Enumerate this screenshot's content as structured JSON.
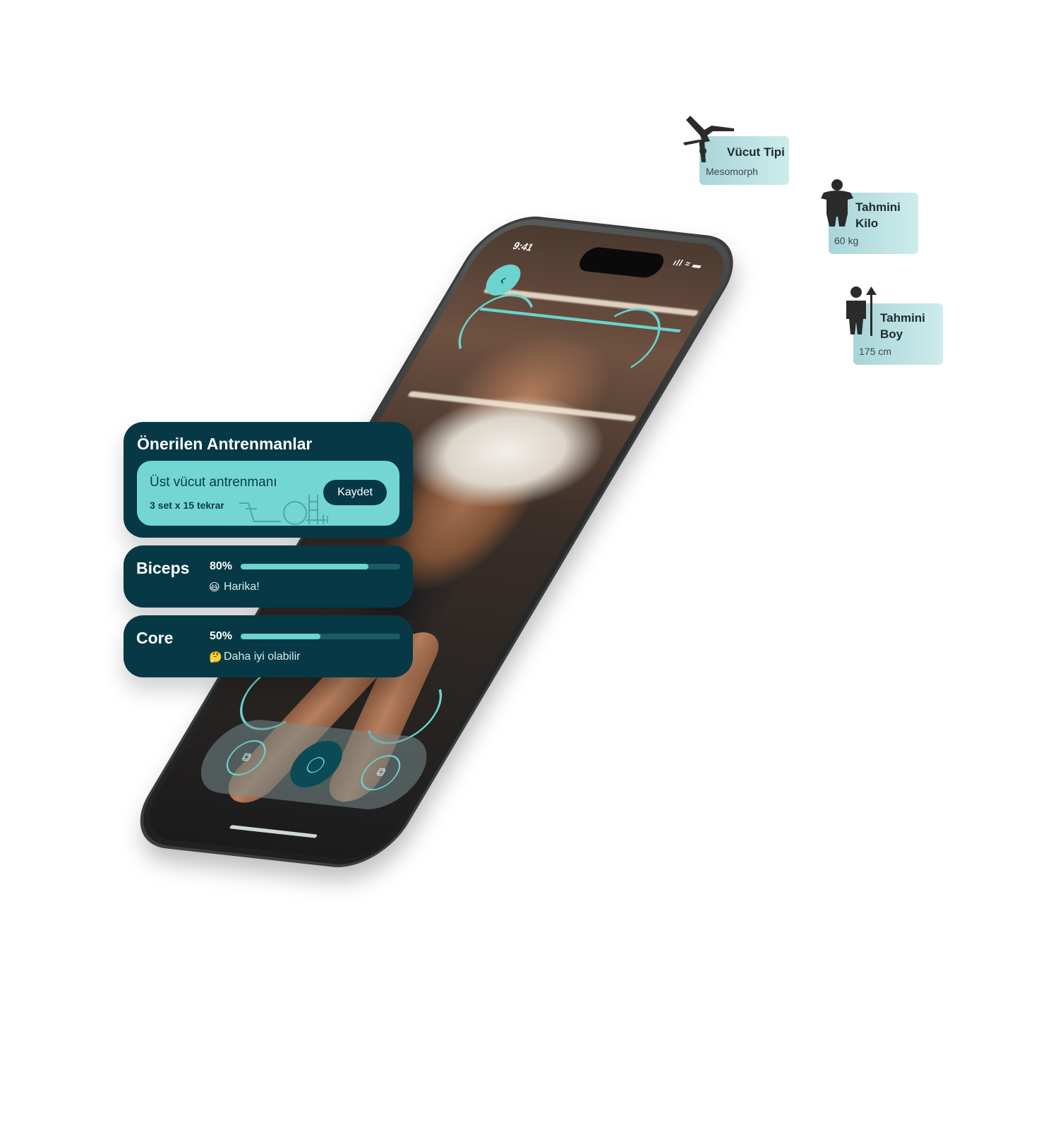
{
  "status_bar": {
    "time": "9:41",
    "icons": "ıll ≈ ▬"
  },
  "camera": {
    "back_icon": "‹",
    "shutter_icon": "◯",
    "left_icon": "⧉",
    "right_icon": "⧉"
  },
  "recommended": {
    "title": "Önerilen Antrenmanlar",
    "workout_name": "Üst vücut antrenmanı",
    "workout_sets": "3 set x 15 tekrar",
    "save_label": "Kaydet"
  },
  "metrics": [
    {
      "name": "Biceps",
      "percent_label": "80%",
      "percent": 80,
      "emoji": "😃",
      "note": "Harika!"
    },
    {
      "name": "Core",
      "percent_label": "50%",
      "percent": 50,
      "emoji": "🤔",
      "note": "Daha iyi olabilir"
    }
  ],
  "tags": [
    {
      "title": "Vücut Tipi",
      "value": "Mesomorph",
      "icon": "handstand-icon"
    },
    {
      "title_line1": "Tahmini",
      "title_line2": "Kilo",
      "value": "60 kg",
      "icon": "body-weight-icon"
    },
    {
      "title_line1": "Tahmini",
      "title_line2": "Boy",
      "value": "175 cm",
      "icon": "body-height-icon"
    }
  ],
  "colors": {
    "accent": "#6cd3cf",
    "card_bg": "#063945",
    "card_inner": "#73d6d3"
  }
}
